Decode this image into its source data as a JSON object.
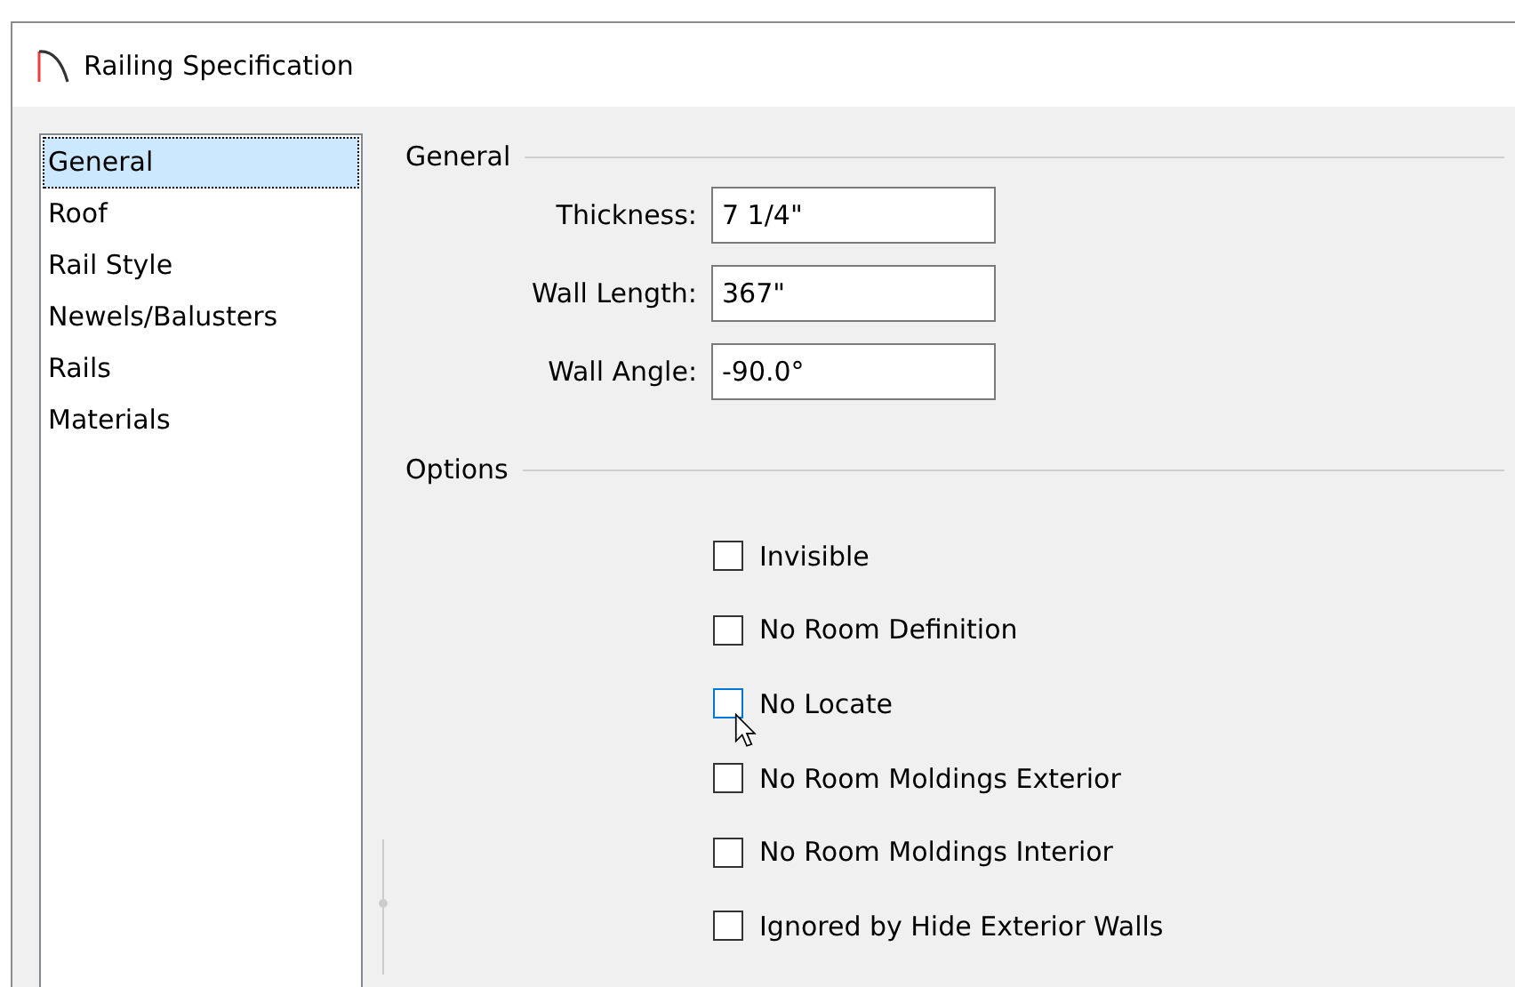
{
  "window": {
    "title": "Railing Specification"
  },
  "sidebar": {
    "items": [
      {
        "label": "General",
        "selected": true
      },
      {
        "label": "Roof",
        "selected": false
      },
      {
        "label": "Rail Style",
        "selected": false
      },
      {
        "label": "Newels/Balusters",
        "selected": false
      },
      {
        "label": "Rails",
        "selected": false
      },
      {
        "label": "Materials",
        "selected": false
      }
    ]
  },
  "general": {
    "title": "General",
    "fields": [
      {
        "label": "Thickness:",
        "value": "7 1/4\""
      },
      {
        "label": "Wall Length:",
        "value": "367\""
      },
      {
        "label": "Wall Angle:",
        "value": "-90.0°"
      }
    ]
  },
  "options": {
    "title": "Options",
    "items": [
      {
        "label": "Invisible",
        "checked": false,
        "hovered": false
      },
      {
        "label": "No Room Definition",
        "checked": false,
        "hovered": false
      },
      {
        "label": "No Locate",
        "checked": false,
        "hovered": true
      },
      {
        "label": "No Room Moldings Exterior",
        "checked": false,
        "hovered": false
      },
      {
        "label": "No Room Moldings Interior",
        "checked": false,
        "hovered": false
      },
      {
        "label": "Ignored by Hide Exterior Walls",
        "checked": false,
        "hovered": false
      }
    ]
  }
}
